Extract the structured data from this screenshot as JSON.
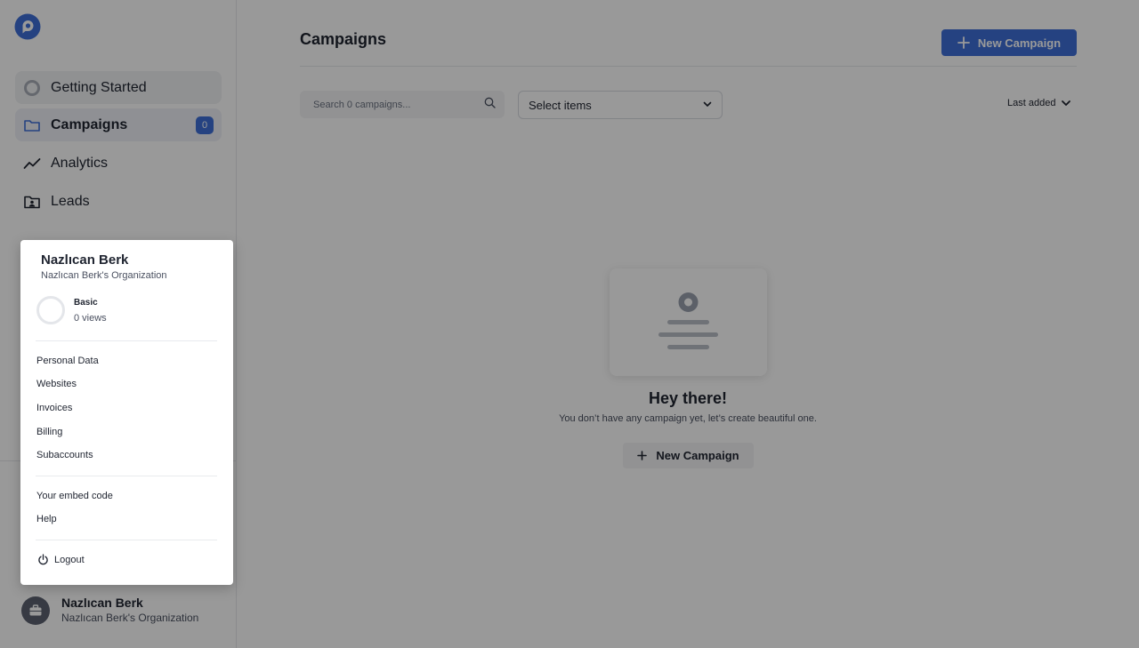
{
  "sidebar": {
    "items": [
      {
        "label": "Getting Started",
        "icon": "circle-progress-icon"
      },
      {
        "label": "Campaigns",
        "icon": "folder-icon",
        "badge": "0"
      },
      {
        "label": "Analytics",
        "icon": "trend-line-icon"
      },
      {
        "label": "Leads",
        "icon": "folder-user-icon"
      }
    ],
    "account": {
      "name": "Nazlıcan Berk",
      "org": "Nazlıcan Berk's Organization"
    }
  },
  "main": {
    "title": "Campaigns",
    "new_campaign_label": "New Campaign",
    "search_placeholder": "Search 0 campaigns...",
    "select_label": "Select items",
    "sort_label": "Last added",
    "empty": {
      "title": "Hey there!",
      "text": "You don’t have any campaign yet, let’s create beautiful one.",
      "button_label": "New Campaign"
    }
  },
  "popup": {
    "name": "Nazlıcan Berk",
    "org": "Nazlıcan Berk's Organization",
    "plan": "Basic",
    "views": "0 views",
    "menu": [
      "Personal Data",
      "Websites",
      "Invoices",
      "Billing",
      "Subaccounts"
    ],
    "menu2": [
      "Your embed code",
      "Help"
    ],
    "logout": "Logout"
  },
  "colors": {
    "accent": "#3e6fd8",
    "overlay": "rgba(0,0,0,0.4)"
  }
}
